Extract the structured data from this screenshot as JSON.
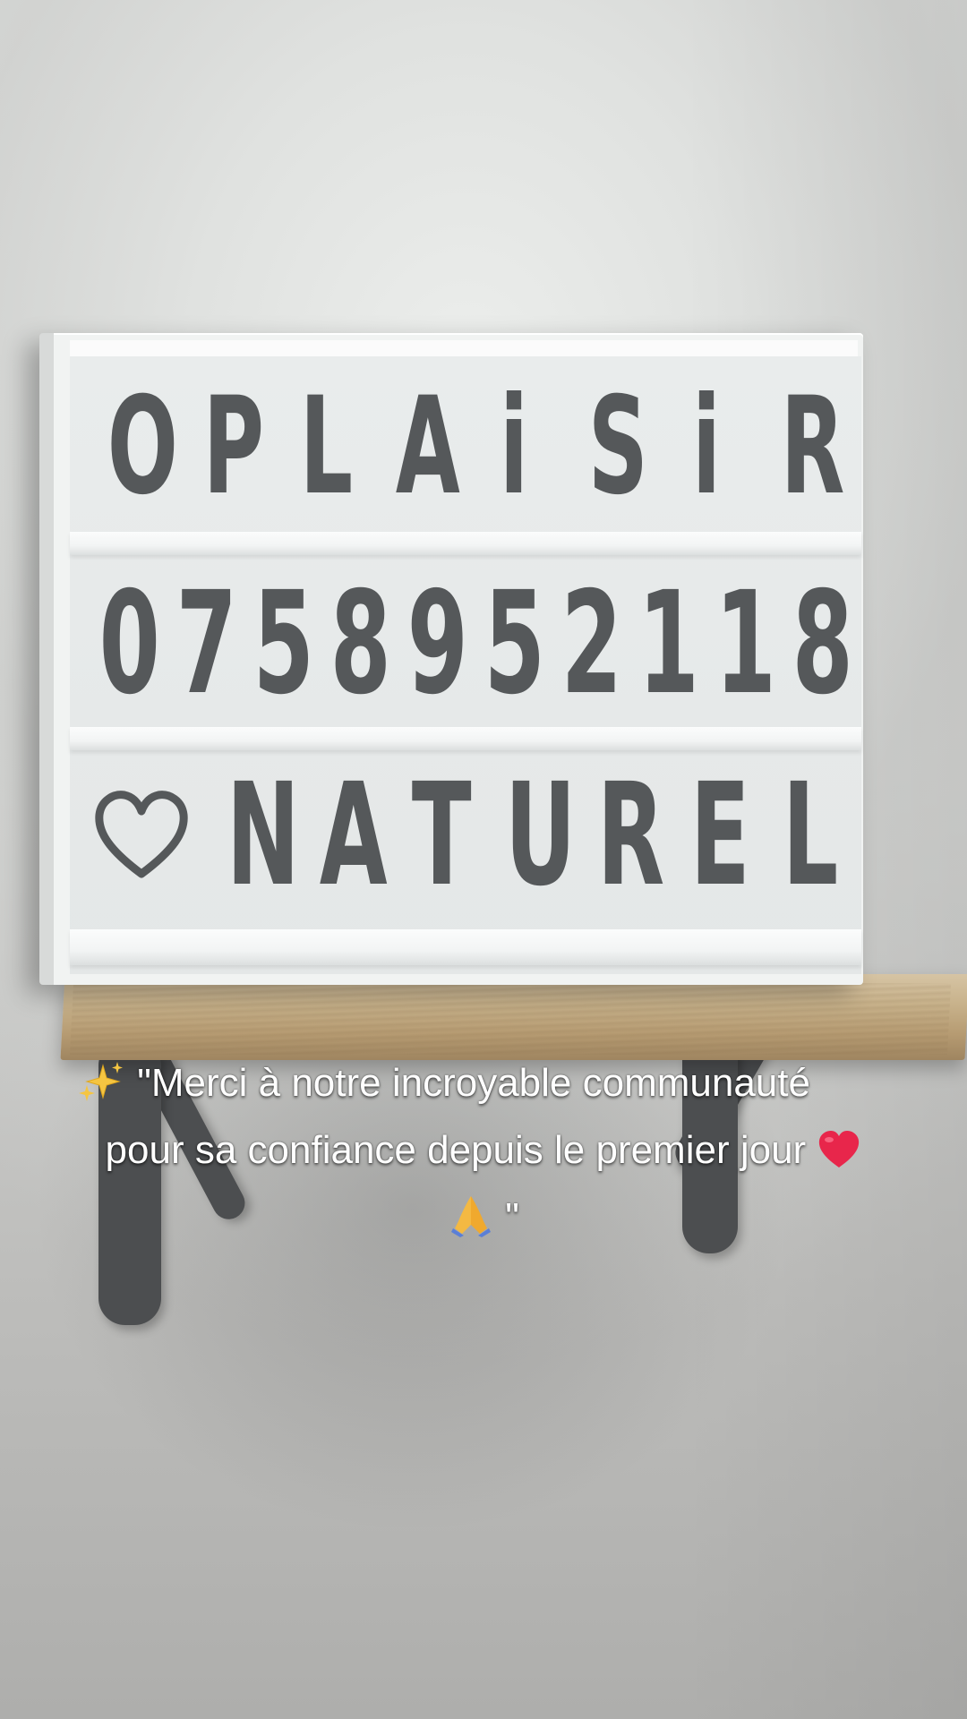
{
  "lightbox": {
    "row_1": [
      "O",
      "P",
      "L",
      "A",
      "i",
      "S",
      "i",
      "R"
    ],
    "row_2": [
      "0",
      "7",
      "5",
      "8",
      "9",
      "5",
      "2",
      "1",
      "1",
      "8"
    ],
    "row_3": [
      "N",
      "A",
      "T",
      "U",
      "R",
      "E",
      "L"
    ],
    "row_3_icon": "heart-outline-icon",
    "letter_color": "#55585a"
  },
  "caption": {
    "open_quote": "\"Merci à notre incroyable communauté",
    "line_2": "pour sa confiance depuis le premier jour",
    "close_quote": "\"",
    "emojis": [
      "sparkles-icon",
      "red-heart-icon",
      "folded-hands-icon"
    ]
  }
}
